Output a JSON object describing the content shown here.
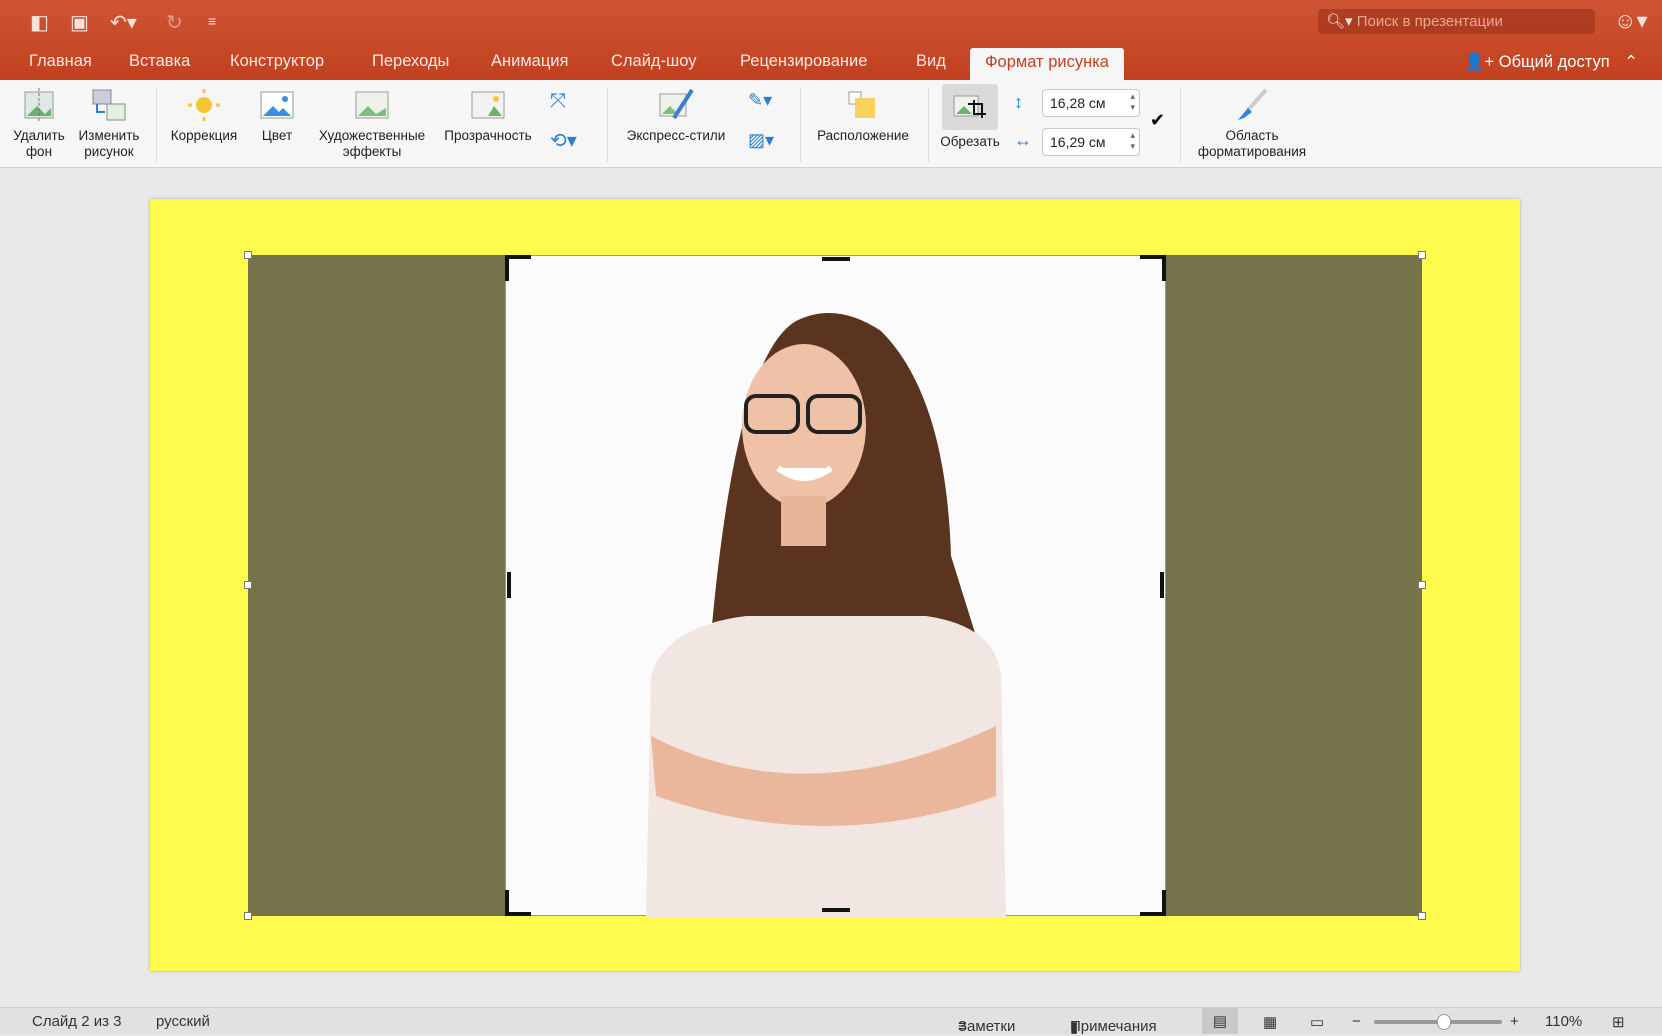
{
  "quick_access": {
    "icons": [
      "sidebar-icon",
      "save-icon",
      "undo-icon",
      "redo-icon",
      "customize-icon"
    ]
  },
  "search": {
    "placeholder": "Поиск в презентации"
  },
  "tabs": [
    "Главная",
    "Вставка",
    "Конструктор",
    "Переходы",
    "Анимация",
    "Слайд-шоу",
    "Рецензирование",
    "Вид",
    "Формат рисунка"
  ],
  "active_tab": "Формат рисунка",
  "share_label": "Общий доступ",
  "ribbon": {
    "remove_bg": "Удалить фон",
    "change_pic": "Изменить рисунок",
    "correction": "Коррекция",
    "color": "Цвет",
    "artistic": "Художественные эффекты",
    "transparency": "Прозрачность",
    "quick_styles": "Экспресс-стили",
    "arrange": "Расположение",
    "crop": "Обрезать",
    "height": "16,28 см",
    "width": "16,29 см",
    "format_pane": "Область форматирования"
  },
  "colors": {
    "accent": "#c4401f",
    "slide_bg": "#fffb4e",
    "olive": "#76724a"
  },
  "status": {
    "slide": "Слайд 2 из 3",
    "language": "русский",
    "notes": "Заметки",
    "comments": "Примечания",
    "zoom": "110%",
    "zoom_fraction": 0.55
  }
}
